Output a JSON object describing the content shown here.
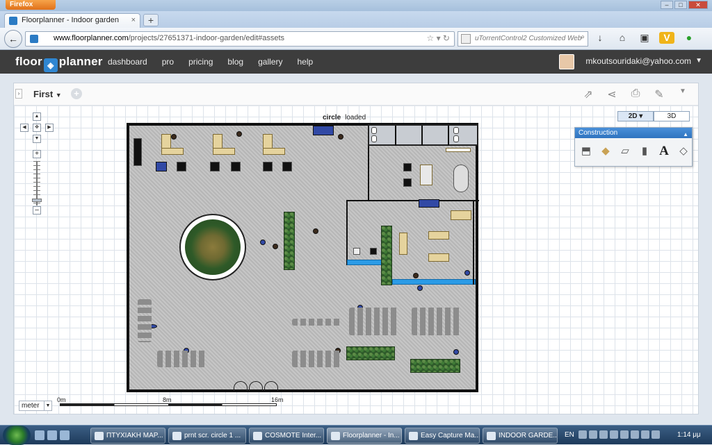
{
  "browser": {
    "menu_button": "Firefox",
    "tab_title": "Floorplanner - Indoor garden",
    "tab_close": "×",
    "new_tab": "+",
    "url_host": "www.floorplanner.com",
    "url_path": "/projects/27651371-indoor-garden/edit#assets",
    "search_placeholder": "uTorrentControl2 Customized Web"
  },
  "app": {
    "logo_left": "floor",
    "logo_right": "planner",
    "nav": [
      "dashboard",
      "pro",
      "pricing",
      "blog",
      "gallery",
      "help"
    ],
    "user_email": "mkoutsouridaki@yahoo.com"
  },
  "editor": {
    "floor_name": "First",
    "add_floor": "+",
    "status_name": "circle",
    "status_text": "loaded",
    "view_2d": "2D ▾",
    "view_3d": "3D",
    "panel_title": "Construction",
    "text_tool": "A",
    "unit": "meter",
    "scale_labels": [
      "0m",
      "8m",
      "16m"
    ]
  },
  "taskbar": {
    "tasks": [
      "ΠΤΥΧΙΑΚΗ ΜΑΡ...",
      "prnt scr. circle 1 ...",
      "COSMOTE Inter...",
      "Floorplanner - In...",
      "Easy Capture Ma...",
      "INDOOR GARDE..."
    ],
    "lang": "EN",
    "clock": "1:14 μμ"
  }
}
